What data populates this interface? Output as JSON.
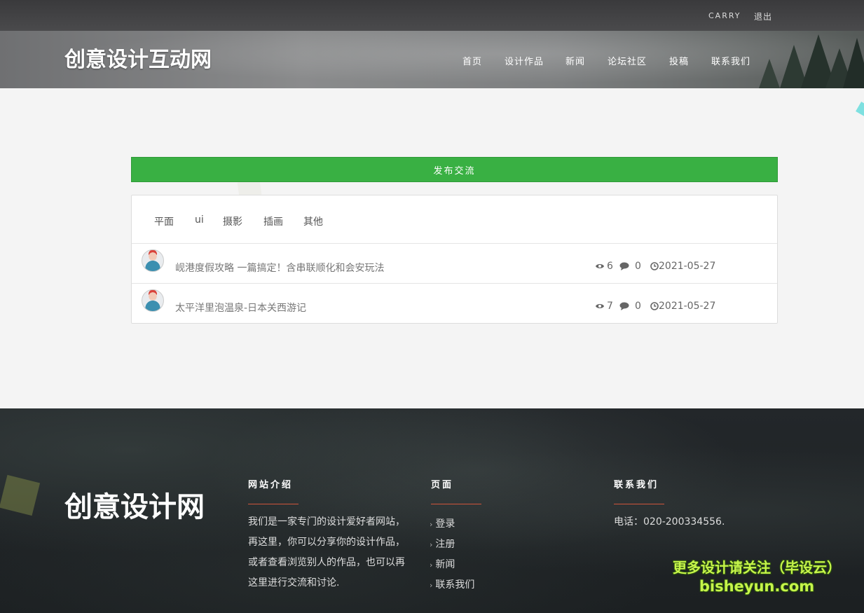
{
  "topbar": {
    "username": "CARRY",
    "logout": "退出"
  },
  "header": {
    "logo": "创意设计互动网",
    "nav": [
      "首页",
      "设计作品",
      "新闻",
      "论坛社区",
      "投稿",
      "联系我们"
    ]
  },
  "main": {
    "publish_button": "发布交流",
    "tabs": [
      "平面",
      "ui",
      "摄影",
      "插画",
      "其他"
    ],
    "posts": [
      {
        "title": "岘港度假攻略 一篇搞定！含串联顺化和会安玩法",
        "views": "6",
        "comments": "0",
        "date": "2021-05-27"
      },
      {
        "title": "太平洋里泡温泉-日本关西游记",
        "views": "7",
        "comments": "0",
        "date": "2021-05-27"
      }
    ]
  },
  "footer": {
    "logo": "创意设计网",
    "about": {
      "title": "网站介绍",
      "lines": [
        "我们是一家专门的设计爱好者网站，",
        "再这里，你可以分享你的设计作品，",
        "或者查看浏览别人的作品，也可以再",
        "这里进行交流和讨论."
      ]
    },
    "pages": {
      "title": "页面",
      "links": [
        "登录",
        "注册",
        "新闻",
        "联系我们"
      ]
    },
    "contact": {
      "title": "联系我们",
      "phone": "电话：020-200334556."
    },
    "watermark": {
      "line1": "更多设计请关注（毕设云）",
      "line2": "bisheyun.com"
    }
  },
  "colors": {
    "accent_green": "#39b043",
    "footer_underline": "#d0553b",
    "watermark": "#c6f54a"
  },
  "icons": [
    "eye-icon",
    "comment-icon",
    "clock-icon",
    "chevron-right-icon"
  ]
}
